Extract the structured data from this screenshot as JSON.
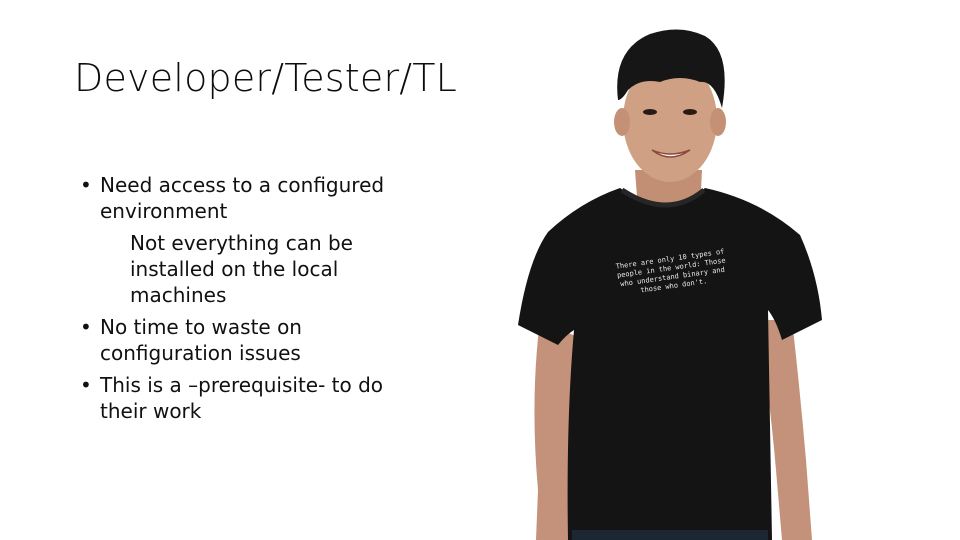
{
  "slide": {
    "title": "Developer/Tester/TL",
    "bullets": [
      {
        "bullet_glyph": "•",
        "text": "Need access to a configured environment",
        "sub": "Not everything can be installed on the local machines"
      },
      {
        "bullet_glyph": "•",
        "text": "No time to waste on configuration issues"
      },
      {
        "bullet_glyph": "•",
        "text": "This is a –prerequisite- to do their work"
      }
    ],
    "image": {
      "subject": "young man in black t-shirt smiling",
      "shirt_text": "There are only 10 types of people in the world: Those who understand binary and those who don't.",
      "colors": {
        "shirt": "#141414",
        "hair": "#161616",
        "skin": "#c99a7c",
        "background": "#ffffff"
      }
    }
  }
}
